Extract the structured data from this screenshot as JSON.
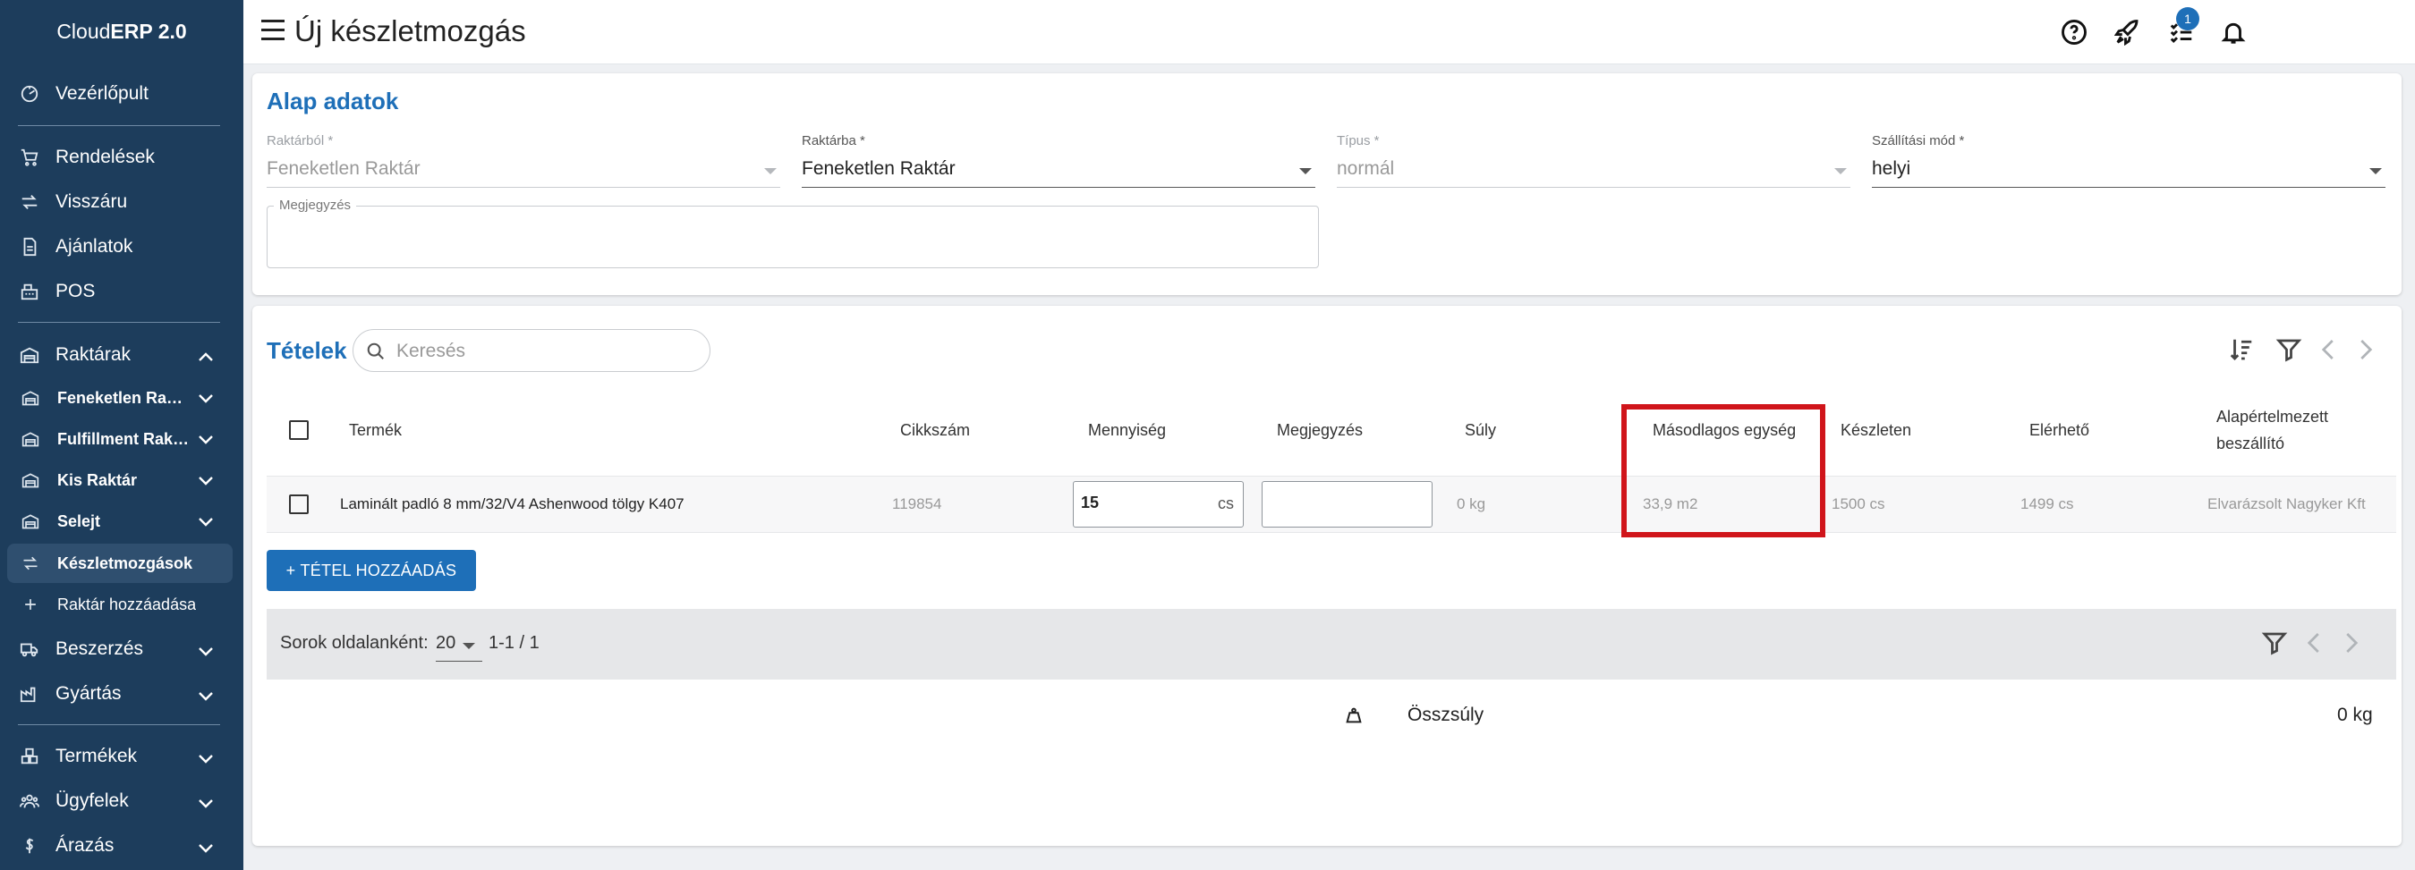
{
  "sidebar": {
    "brand_prefix": "Cloud",
    "brand_bold": "ERP 2.0",
    "items": [
      {
        "label": "Vezérlőpult",
        "icon": "dashboard-icon"
      },
      {
        "label": "Rendelések",
        "icon": "cart-icon"
      },
      {
        "label": "Visszáru",
        "icon": "return-arrows-icon"
      },
      {
        "label": "Ajánlatok",
        "icon": "document-icon"
      },
      {
        "label": "POS",
        "icon": "cash-register-icon"
      },
      {
        "label": "Raktárak",
        "icon": "warehouse-icon"
      },
      {
        "label": "Feneketlen Raktár",
        "icon": "warehouse-icon"
      },
      {
        "label": "Fulfillment Raktár",
        "icon": "warehouse-icon"
      },
      {
        "label": "Kis Raktár",
        "icon": "warehouse-icon"
      },
      {
        "label": "Selejt",
        "icon": "warehouse-icon"
      },
      {
        "label": "Készletmozgások",
        "icon": "transfer-arrows-icon"
      },
      {
        "label": "Raktár hozzáadása",
        "icon": "plus-icon"
      },
      {
        "label": "Beszerzés",
        "icon": "truck-icon"
      },
      {
        "label": "Gyártás",
        "icon": "factory-icon"
      },
      {
        "label": "Termékek",
        "icon": "boxes-icon"
      },
      {
        "label": "Ügyfelek",
        "icon": "users-icon"
      },
      {
        "label": "Árazás",
        "icon": "dollar-icon"
      }
    ]
  },
  "header": {
    "title": "Új készletmozgás",
    "notification_badge": "1"
  },
  "basic": {
    "title": "Alap adatok",
    "from_label": "Raktárból *",
    "from_value": "Feneketlen Raktár",
    "to_label": "Raktárba *",
    "to_value": "Feneketlen Raktár",
    "type_label": "Típus *",
    "type_value": "normál",
    "shipping_label": "Szállítási mód *",
    "shipping_value": "helyi",
    "note_label": "Megjegyzés"
  },
  "items": {
    "title": "Tételek",
    "search_placeholder": "Keresés",
    "columns": [
      "Termék",
      "Cikkszám",
      "Mennyiség",
      "Megjegyzés",
      "Súly",
      "Másodlagos egység",
      "Készleten",
      "Elérhető",
      "Alapértelmezett",
      "beszállító"
    ],
    "rows": [
      {
        "product": "Laminált padló 8 mm/32/V4 Ashenwood tölgy K407",
        "sku": "119854",
        "quantity": "15",
        "unit": "cs",
        "note": "",
        "weight": "0 kg",
        "secondary_unit": "33,9 m2",
        "in_stock": "1500 cs",
        "available": "1499 cs",
        "supplier": "Elvarázsolt Nagyker Kft"
      }
    ],
    "add_button": "+ TÉTEL HOZZÁADÁS",
    "rows_per_page_label": "Sorok oldalanként:",
    "rows_per_page_value": "20",
    "pagination": "1-1 / 1",
    "total_weight_label": "Összsúly",
    "total_weight_value": "0 kg"
  },
  "colors": {
    "sidebar_bg": "#1d3d5c",
    "accent": "#1e6fb8",
    "highlight": "#d0151b"
  }
}
